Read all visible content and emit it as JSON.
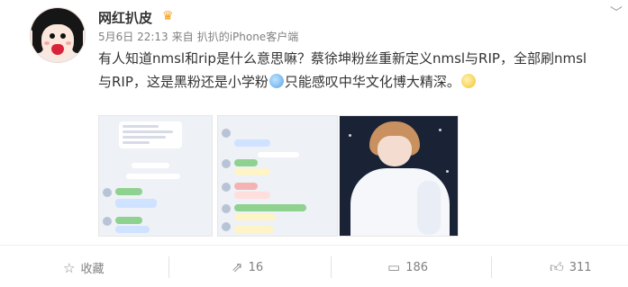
{
  "post": {
    "username": "网红扒皮",
    "date": "5月6日 22:13",
    "source_prefix": "来自",
    "source": "扒扒的iPhone客户端",
    "text_line1": "有人知道nmsl和rip是什么意思嘛？蔡徐坤粉丝重新定义nmsl与RIP，全部刷nmsl",
    "text_line2a": "与RIP，这是黑粉还是小学粉",
    "text_line2b": "只能感叹中华文化博大精深。"
  },
  "actions": {
    "favorite_label": "收藏",
    "repost_count": "16",
    "comment_count": "186",
    "like_count": "311"
  },
  "icons": {
    "favorite": "star-outline-icon",
    "repost": "share-icon",
    "comment": "comment-icon",
    "like": "thumb-up-icon"
  },
  "colors": {
    "text": "#333333",
    "meta": "#808080"
  }
}
